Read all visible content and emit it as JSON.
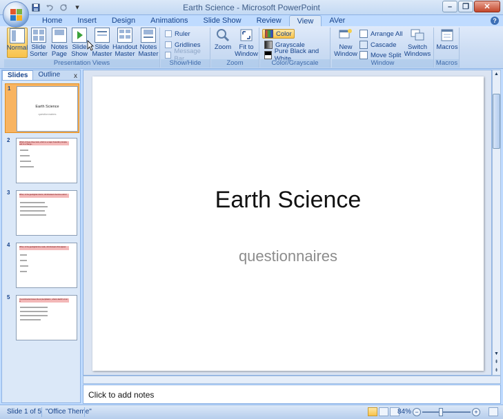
{
  "window": {
    "title": "Earth Science - Microsoft PowerPoint",
    "minimize": "–",
    "restore": "❐",
    "close": "✕"
  },
  "qat": {
    "save": "💾",
    "undo": "↶",
    "redo": "↻",
    "more": "▾"
  },
  "tabs": [
    "Home",
    "Insert",
    "Design",
    "Animations",
    "Slide Show",
    "Review",
    "View",
    "AVer"
  ],
  "active_tab": "View",
  "help": "?",
  "ribbon": {
    "presentation_views": {
      "label": "Presentation Views",
      "buttons": [
        "Normal",
        "Slide Sorter",
        "Notes Page",
        "Slide Show",
        "Slide Master",
        "Handout Master",
        "Notes Master"
      ]
    },
    "show_hide": {
      "label": "Show/Hide",
      "items": [
        "Ruler",
        "Gridlines",
        "Message Bar"
      ]
    },
    "zoom": {
      "label": "Zoom",
      "buttons": [
        "Zoom",
        "Fit to Window"
      ]
    },
    "color_grayscale": {
      "label": "Color/Grayscale",
      "items": [
        "Color",
        "Grayscale",
        "Pure Black and White"
      ]
    },
    "window": {
      "label": "Window",
      "new_window": "New Window",
      "items": [
        "Arrange All",
        "Cascade",
        "Move Split"
      ],
      "switch": "Switch Windows"
    },
    "macros": {
      "label": "Macros",
      "button": "Macros"
    }
  },
  "panel": {
    "tabs": [
      "Slides",
      "Outline"
    ],
    "close": "x"
  },
  "slides": [
    {
      "num": "1",
      "title": "Earth Science",
      "subtitle": "questionnaires"
    },
    {
      "num": "2",
      "heading": "Which of these three facts, which is a major Scientific principle and in a change..."
    },
    {
      "num": "3",
      "heading": "When, in the geological column, did dinosaurs become extinct"
    },
    {
      "num": "4",
      "heading": "When, in the geological time scale, did dinosaurs first appear"
    },
    {
      "num": "5",
      "heading": "If a continental moves the at precipitation , what is Earth's crust is"
    }
  ],
  "main_slide": {
    "title": "Earth Science",
    "subtitle": "questionnaires"
  },
  "notes": {
    "placeholder": "Click to add notes"
  },
  "status": {
    "slide_info": "Slide 1 of 5",
    "theme": "\"Office Theme\"",
    "zoom": "84%",
    "zoom_out": "−",
    "zoom_in": "+"
  },
  "scroll": {
    "up": "▲",
    "down": "▼",
    "prev": "⇞",
    "next": "⇟"
  }
}
